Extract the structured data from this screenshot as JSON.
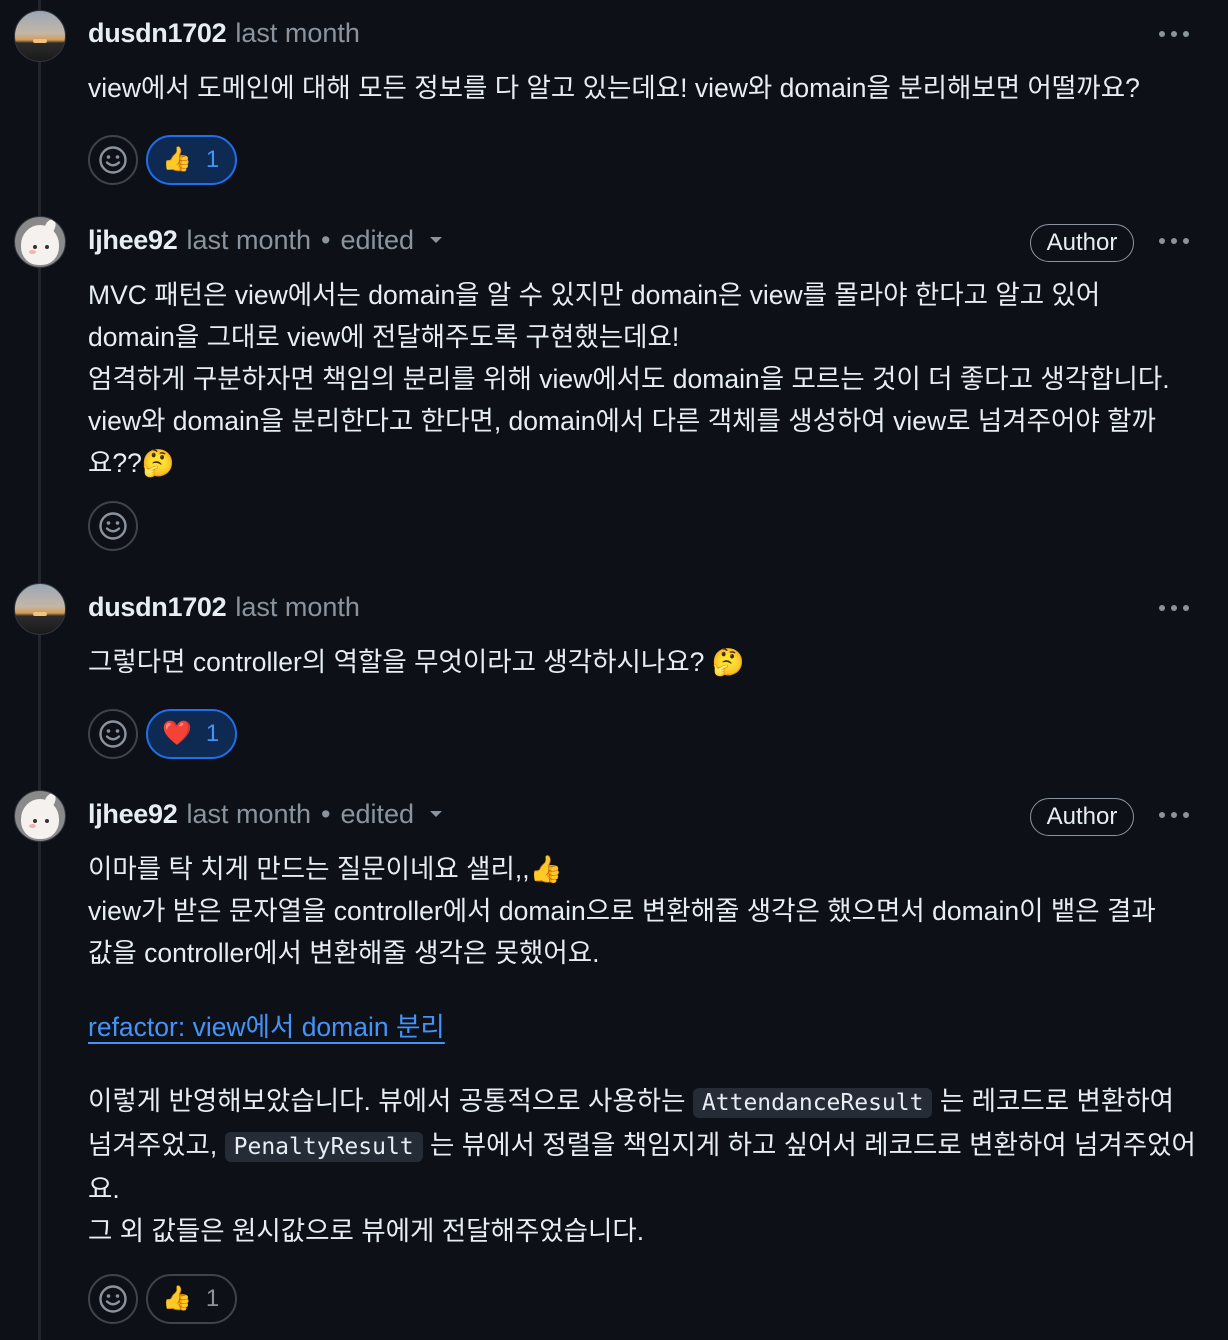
{
  "comments": [
    {
      "author": "dusdn1702",
      "time": "last month",
      "body": [
        "view에서 도메인에 대해 모든 정보를 다 알고 있는데요! view와 domain을 분리해보면 어떨까요?"
      ],
      "reaction": {
        "emoji": "👍",
        "count": "1",
        "active": true
      }
    },
    {
      "author": "ljhee92",
      "time": "last month",
      "separator": "•",
      "edited": "edited",
      "badge": "Author",
      "body": [
        "MVC 패턴은 view에서는 domain을 알 수 있지만 domain은 view를 몰라야 한다고 알고 있어",
        "domain을 그대로 view에 전달해주도록 구현했는데요!",
        "엄격하게 구분하자면 책임의 분리를 위해 view에서도 domain을 모르는 것이 더 좋다고 생각합니다.",
        "view와 domain을 분리한다고 한다면, domain에서 다른 객체를 생성하여 view로 넘겨주어야 할까",
        "요??🤔"
      ]
    },
    {
      "author": "dusdn1702",
      "time": "last month",
      "body": [
        "그렇다면 controller의 역할을 무엇이라고 생각하시나요? 🤔"
      ],
      "reaction": {
        "emoji": "❤️",
        "count": "1",
        "active": true
      }
    },
    {
      "author": "ljhee92",
      "time": "last month",
      "separator": "•",
      "edited": "edited",
      "badge": "Author",
      "body": [
        "이마를 탁 치게 만드는 질문이네요 샐리,,👍",
        "view가 받은 문자열을 controller에서 domain으로 변환해줄 생각은 했으면서 domain이 뱉은 결과",
        "값을 controller에서 변환해줄 생각은 못했어요."
      ],
      "link": "refactor: view에서 domain 분리",
      "para": {
        "t1": "이렇게 반영해보았습니다. 뷰에서 공통적으로 사용하는 ",
        "code1": "AttendanceResult",
        "t2": " 는 레코드로 변환하여",
        "t3": "넘겨주었고, ",
        "code2": "PenaltyResult",
        "t4": " 는 뷰에서 정렬을 책임지게 하고 싶어서 레코드로 변환하여 넘겨주었어",
        "t5": "요.",
        "t6": "그 외 값들은 원시값으로 뷰에게 전달해주었습니다."
      },
      "reaction": {
        "emoji": "👍",
        "count": "1",
        "active": false
      }
    }
  ],
  "icons": {
    "add_reaction": "smiley-icon",
    "menu": "kebab-icon"
  },
  "colors": {
    "background": "#0d1117",
    "link": "#4493f8",
    "muted": "#8b949e",
    "active_reaction_border": "#1f6feb"
  }
}
